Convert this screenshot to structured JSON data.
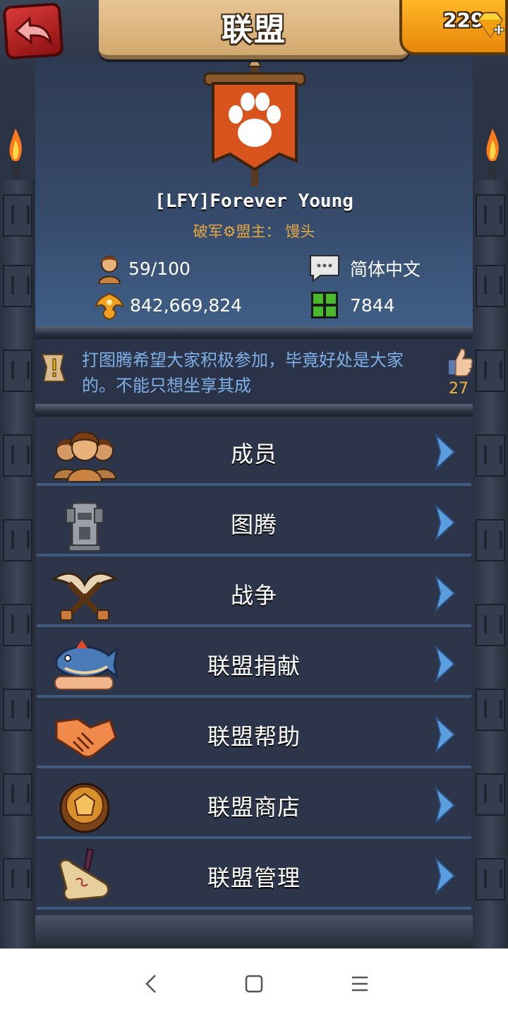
{
  "header": {
    "title": "联盟",
    "gems": "229"
  },
  "alliance": {
    "name": "[LFY]Forever Young",
    "leader_line": "破军⚙盟主：  馒头",
    "members": "59/100",
    "language": "简体中文",
    "power": "842,669,824",
    "territory": "7844"
  },
  "notice": {
    "text": "打图腾希望大家积极参加，毕竟好处是大家的。不能只想坐享其成",
    "likes": "27"
  },
  "menu": [
    {
      "label": "成员",
      "icon": "members-icon"
    },
    {
      "label": "图腾",
      "icon": "totem-icon"
    },
    {
      "label": "战争",
      "icon": "war-icon"
    },
    {
      "label": "联盟捐献",
      "icon": "donation-icon"
    },
    {
      "label": "联盟帮助",
      "icon": "handshake-icon"
    },
    {
      "label": "联盟商店",
      "icon": "shop-icon"
    },
    {
      "label": "联盟管理",
      "icon": "scroll-icon"
    }
  ],
  "colors": {
    "accent_gold": "#e8a93f",
    "notice_text": "#7fb0e8",
    "chevron_blue": "#5b9ee0",
    "flag_orange": "#d9531c"
  },
  "navbar": {
    "back": "chevron-left-icon",
    "home": "square-icon",
    "menu": "hamburger-icon"
  }
}
